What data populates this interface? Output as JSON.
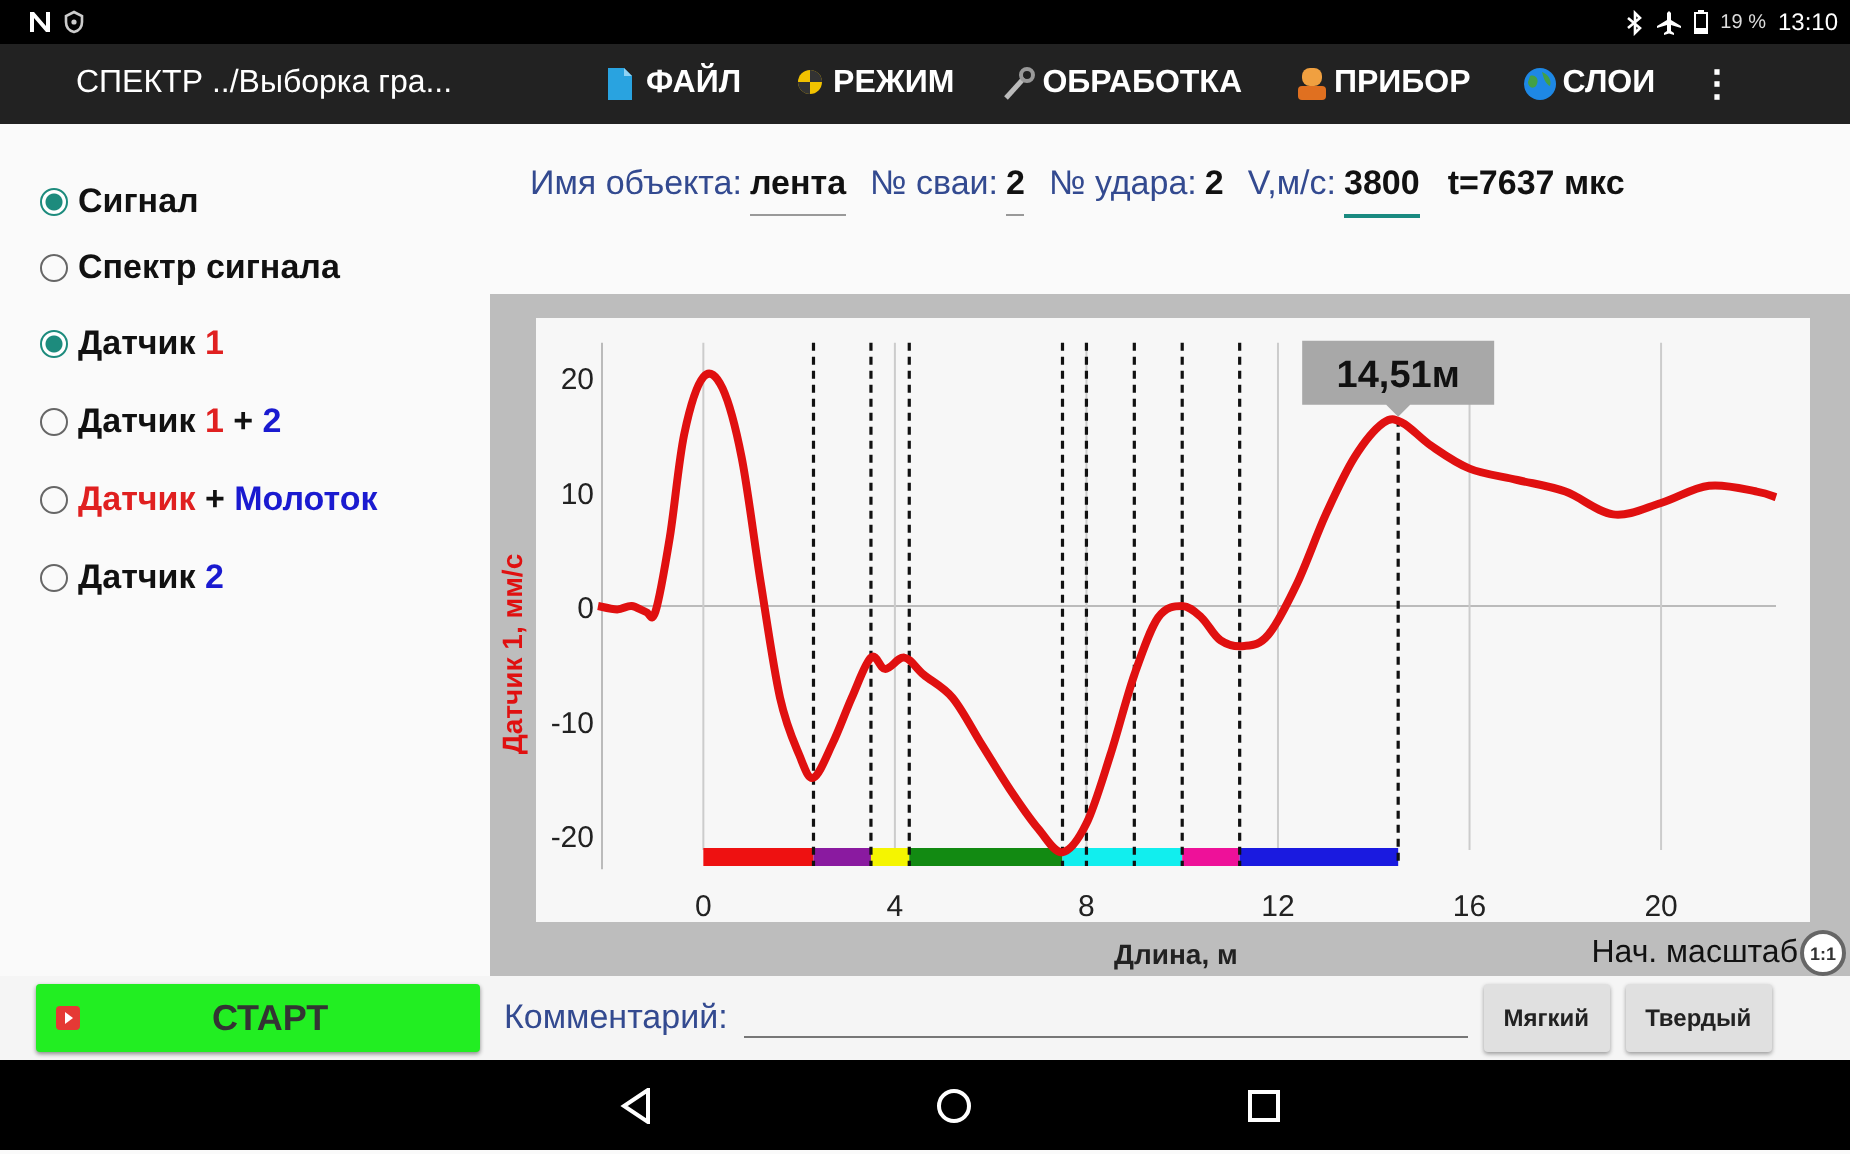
{
  "status_bar": {
    "time": "13:10",
    "battery_text": "19 %"
  },
  "app_bar": {
    "title": "СПЕКТР ../Выборка гра...",
    "menu": [
      {
        "label": "ФАЙЛ",
        "kind": "file"
      },
      {
        "label": "РЕЖИМ",
        "kind": "mode"
      },
      {
        "label": "ОБРАБОТКА",
        "kind": "tool"
      },
      {
        "label": "ПРИБОР",
        "kind": "device"
      },
      {
        "label": "СЛОИ",
        "kind": "layers"
      }
    ],
    "overflow": "⋮"
  },
  "options": [
    {
      "selected": true,
      "parts": [
        {
          "text": "Сигнал",
          "color": "#111111"
        }
      ]
    },
    {
      "selected": false,
      "parts": [
        {
          "text": "Спектр сигнала",
          "color": "#111111"
        }
      ]
    },
    {
      "selected": true,
      "parts": [
        {
          "text": "Датчик ",
          "color": "#111111"
        },
        {
          "text": "1",
          "color": "#e02020"
        }
      ]
    },
    {
      "selected": false,
      "parts": [
        {
          "text": "Датчик ",
          "color": "#111111"
        },
        {
          "text": "1",
          "color": "#e02020"
        },
        {
          "text": " + ",
          "color": "#111111"
        },
        {
          "text": "2",
          "color": "#1a1ad0"
        }
      ]
    },
    {
      "selected": false,
      "parts": [
        {
          "text": "Датчик",
          "color": "#e02020"
        },
        {
          "text": " + ",
          "color": "#111111"
        },
        {
          "text": "Молоток",
          "color": "#1a1ad0"
        }
      ]
    },
    {
      "selected": false,
      "parts": [
        {
          "text": "Датчик ",
          "color": "#111111"
        },
        {
          "text": "2",
          "color": "#1a1ad0"
        }
      ]
    }
  ],
  "fields": [
    {
      "kind": "input",
      "label": "Имя объекта:",
      "value": "лента",
      "focused": false
    },
    {
      "kind": "input",
      "label": "№ сваи:",
      "value": "2",
      "focused": false
    },
    {
      "kind": "text",
      "label": "№ удара:",
      "value": "2"
    },
    {
      "kind": "input",
      "label": "V,м/с:",
      "value": "3800",
      "focused": true
    },
    {
      "kind": "plain",
      "value": "t=7637 мкс"
    }
  ],
  "chart": {
    "chart_data": {
      "type": "line",
      "ylabel": "Датчик 1, мм/с",
      "xlabel": "Длина, м",
      "grid": true,
      "x": [
        -2.2,
        -1.8,
        -1.5,
        -1.2,
        -1.0,
        -0.7,
        -0.4,
        0,
        0.4,
        0.8,
        1.2,
        1.6,
        2.0,
        2.3,
        2.7,
        3.1,
        3.5,
        3.8,
        4.2,
        4.6,
        5.2,
        5.8,
        6.4,
        7.0,
        7.5,
        8.0,
        8.5,
        9.0,
        9.5,
        10.0,
        10.4,
        10.8,
        11.3,
        11.8,
        12.4,
        13.0,
        13.6,
        14.2,
        14.6,
        15.2,
        16.0,
        17.0,
        18.0,
        19.0,
        20.0,
        21.0,
        22.0,
        22.4
      ],
      "series": [
        {
          "color": "#e01010",
          "values": [
            0,
            -0.3,
            0,
            -0.5,
            -0.5,
            6,
            15,
            20,
            19,
            13,
            2,
            -8,
            -13,
            -15,
            -12,
            -8,
            -4.5,
            -5.5,
            -4.5,
            -6,
            -8,
            -12,
            -16,
            -19.5,
            -21.5,
            -19,
            -13,
            -6,
            -1,
            0,
            -1,
            -3,
            -3.5,
            -2.5,
            2,
            8,
            13,
            16,
            16,
            14,
            12,
            11,
            10,
            8,
            9,
            10.5,
            10,
            9.5
          ]
        }
      ],
      "xlim": [
        -2.2,
        22.4
      ],
      "ylim": [
        -23,
        23
      ],
      "xticks": [
        0,
        4,
        8,
        12,
        16,
        20
      ],
      "yticks": [
        -20,
        -10,
        0,
        10,
        20
      ],
      "annotations": [
        {
          "x": 14.51,
          "y": 16,
          "text": "14,51м"
        }
      ]
    },
    "segments": [
      {
        "color": "#ee1111"
      },
      {
        "color": "#8a1aa0"
      },
      {
        "color": "#f5f500"
      },
      {
        "color": "#128a12"
      },
      {
        "color": "#11eeee"
      },
      {
        "color": "#ee1199"
      },
      {
        "color": "#1a1ae0"
      }
    ],
    "reset_label": "Нач. масштаб",
    "zoom_badge": "1:1"
  },
  "bottom": {
    "start": "СТАРТ",
    "comment_label": "Комментарий:",
    "buttons": [
      "Мягкий",
      "Твердый"
    ]
  }
}
